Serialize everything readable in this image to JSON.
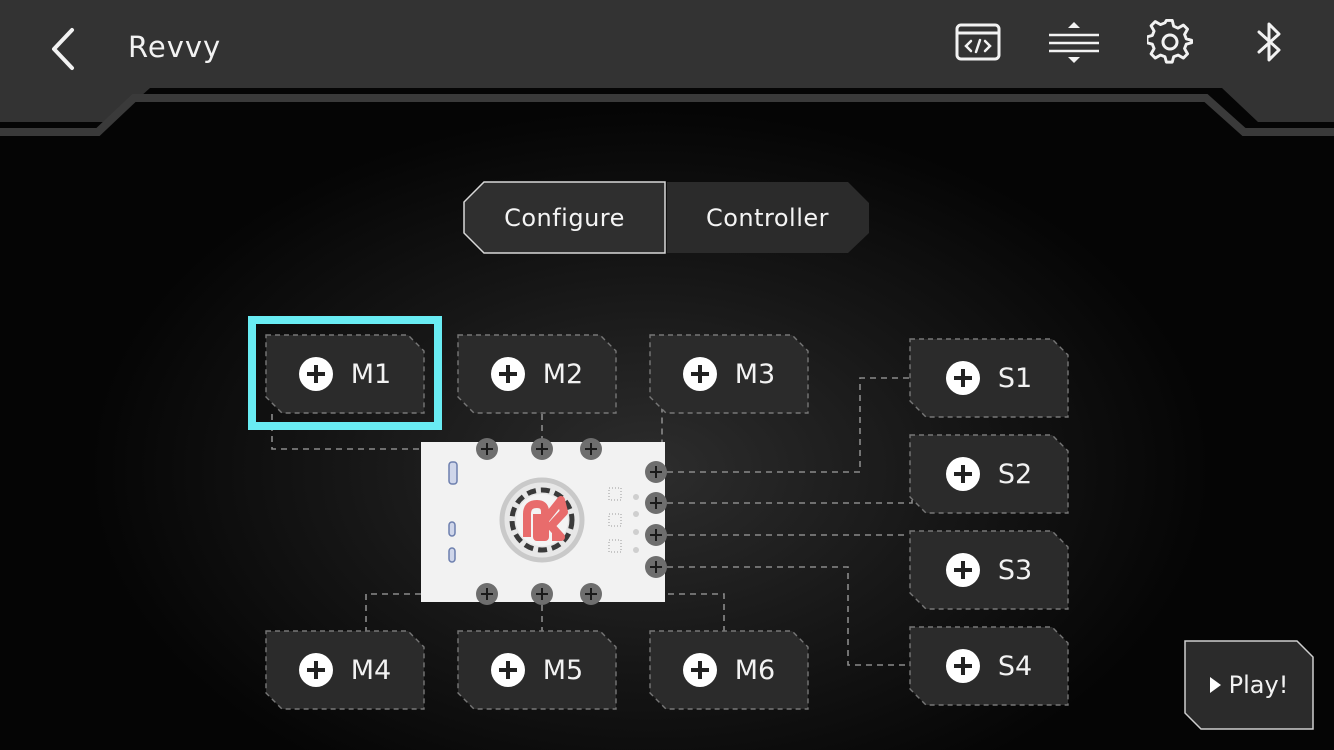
{
  "header": {
    "title": "Revvy",
    "icons": [
      "back-arrow-icon",
      "code-view-icon",
      "expand-collapse-icon",
      "gear-icon",
      "bluetooth-icon"
    ]
  },
  "tabs": [
    {
      "label": "Configure",
      "active": true
    },
    {
      "label": "Controller",
      "active": false
    }
  ],
  "motor_ports": [
    {
      "label": "M1",
      "selected": true
    },
    {
      "label": "M2",
      "selected": false
    },
    {
      "label": "M3",
      "selected": false
    },
    {
      "label": "M4",
      "selected": false
    },
    {
      "label": "M5",
      "selected": false
    },
    {
      "label": "M6",
      "selected": false
    }
  ],
  "sensor_ports": [
    {
      "label": "S1"
    },
    {
      "label": "S2"
    },
    {
      "label": "S3"
    },
    {
      "label": "S4"
    }
  ],
  "play_button": {
    "label": "Play!"
  },
  "colors": {
    "selected_highlight": "#69ecf3",
    "logo_red": "#e86c6c",
    "port_fill": "#2b2b2b"
  }
}
